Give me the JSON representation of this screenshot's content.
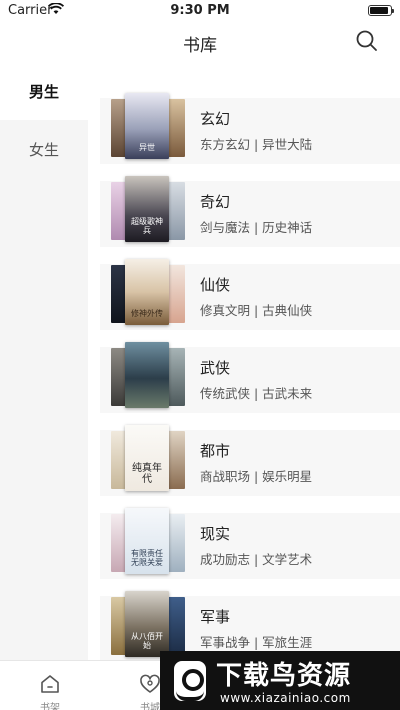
{
  "status_bar": {
    "carrier": "Carrier",
    "time": "9:30 PM",
    "battery_level": 0.9
  },
  "nav": {
    "title": "书库"
  },
  "sidebar": {
    "items": [
      {
        "label": "男生",
        "active": true
      },
      {
        "label": "女生",
        "active": false
      }
    ]
  },
  "categories": [
    {
      "name": "玄幻",
      "desc": "东方玄幻 | 异世大陆",
      "cover_text": "异世"
    },
    {
      "name": "奇幻",
      "desc": "剑与魔法 | 历史神话",
      "cover_text": "超级歌神兵"
    },
    {
      "name": "仙侠",
      "desc": "修真文明 | 古典仙侠",
      "cover_text": "修神外传"
    },
    {
      "name": "武侠",
      "desc": "传统武侠 | 古武未来",
      "cover_text": ""
    },
    {
      "name": "都市",
      "desc": "商战职场 | 娱乐明星",
      "cover_text": "纯真年代"
    },
    {
      "name": "现实",
      "desc": "成功励志 | 文学艺术",
      "cover_text": "有限责任无限关爱"
    },
    {
      "name": "军事",
      "desc": "军事战争 | 军旅生涯",
      "cover_text": "从八佰开始"
    }
  ],
  "tabbar": {
    "tabs": [
      {
        "label": "书架",
        "icon": "home-icon"
      },
      {
        "label": "书城",
        "icon": "heart-icon"
      },
      {
        "label": "",
        "icon": ""
      },
      {
        "label": "",
        "icon": ""
      },
      {
        "label": "",
        "icon": ""
      }
    ]
  },
  "watermark": {
    "cn": "下载鸟资源",
    "url": "www.xiazainiao.com"
  },
  "colors": {
    "accent": "#e33333",
    "sidebar_bg": "#f5f5f5",
    "row_bg": "#f7f7f7"
  }
}
